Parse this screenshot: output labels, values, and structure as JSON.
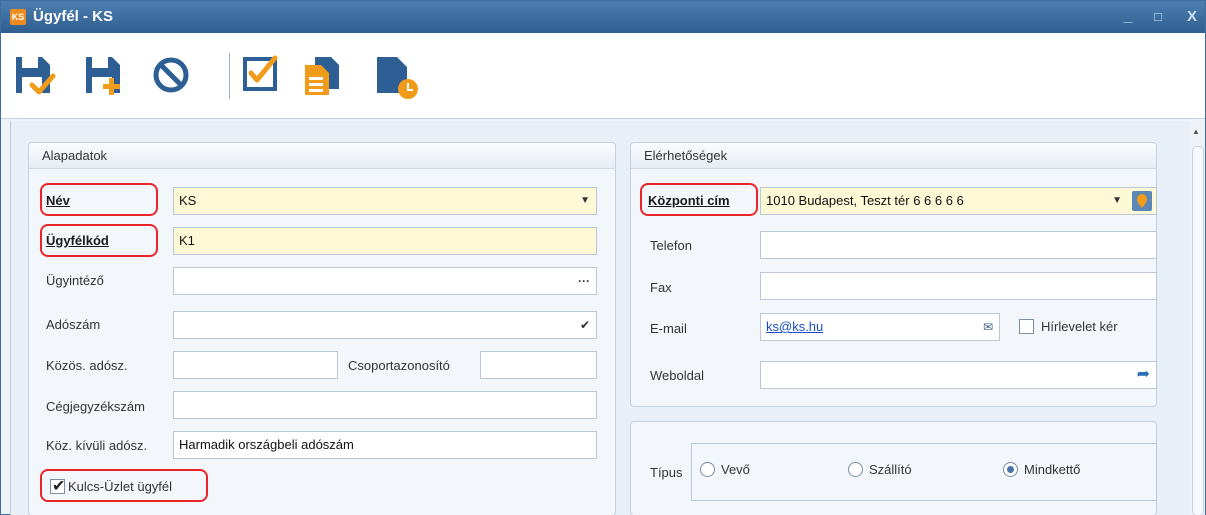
{
  "window": {
    "app_badge": "KS",
    "title": "Ügyfél - KS",
    "minimize": "_",
    "maximize": "□",
    "close": "X"
  },
  "toolbar": {
    "buttons": [
      {
        "icon": "save-check-icon"
      },
      {
        "icon": "save-new-icon"
      },
      {
        "icon": "cancel-icon"
      },
      {
        "icon": "checklist-icon"
      },
      {
        "icon": "copy-document-icon"
      },
      {
        "icon": "document-clock-icon"
      }
    ]
  },
  "colors": {
    "accent": "#2e5f92",
    "required_field": "#fdf8d6",
    "highlight": "#e8262a"
  },
  "basic": {
    "header": "Alapadatok",
    "name_label": "Név",
    "name_value": "KS",
    "code_label": "Ügyfélkód",
    "code_value": "K1",
    "agent_label": "Ügyintéző",
    "agent_value": "",
    "tax_label": "Adószám",
    "tax_value": "",
    "common_tax_label": "Közös. adósz.",
    "common_tax_value": "",
    "group_id_label": "Csoportazonosító",
    "group_id_value": "",
    "company_reg_label": "Cégjegyzékszám",
    "company_reg_value": "",
    "foreign_tax_label": "Köz. kívüli adósz.",
    "foreign_tax_value": "Harmadik országbeli adószám",
    "kulcs_checkbox_label": "Kulcs-Üzlet ügyfél",
    "kulcs_checked": true
  },
  "contact": {
    "header": "Elérhetőségek",
    "address_label": "Központi cím",
    "address_value": "1010 Budapest, Teszt tér 6 6 6 6 6",
    "phone_label": "Telefon",
    "phone_value": "",
    "fax_label": "Fax",
    "fax_value": "",
    "email_label": "E-mail",
    "email_value": "ks@ks.hu",
    "newsletter_label": "Hírlevelet kér",
    "newsletter_checked": false,
    "website_label": "Weboldal",
    "website_value": ""
  },
  "type": {
    "label": "Típus",
    "options": [
      "Vevő",
      "Szállító",
      "Mindkettő"
    ],
    "selected": "Mindkettő"
  }
}
